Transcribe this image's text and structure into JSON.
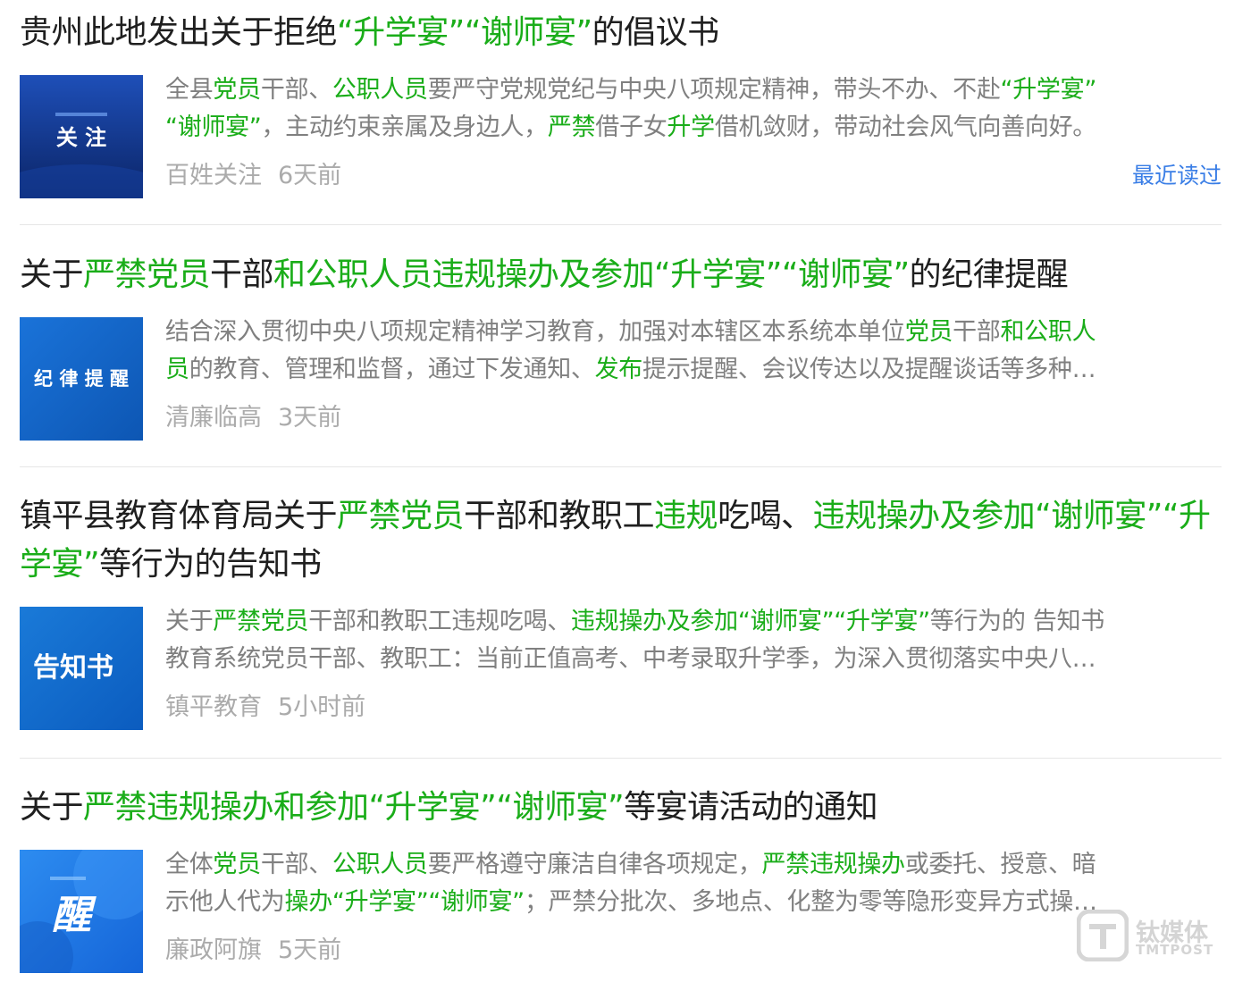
{
  "results": [
    {
      "title_parts": [
        {
          "text": "贵州此地发出关于拒绝",
          "hl": false
        },
        {
          "text": "“升学宴”“谢师宴”",
          "hl": true
        },
        {
          "text": "的倡议书",
          "hl": false
        }
      ],
      "thumbnail": {
        "text": "关 注",
        "icon": "news-thumbnail"
      },
      "summary_lines": [
        [
          {
            "text": "全县",
            "hl": false
          },
          {
            "text": "党员",
            "hl": true
          },
          {
            "text": "干部、",
            "hl": false
          },
          {
            "text": "公职人员",
            "hl": true
          },
          {
            "text": "要严守党规党纪与中央八项规定精神，带头不办、不赴",
            "hl": false
          },
          {
            "text": "“升学宴”",
            "hl": true
          }
        ],
        [
          {
            "text": "“谢师宴”",
            "hl": true
          },
          {
            "text": "，主动约束亲属及身边人，",
            "hl": false
          },
          {
            "text": "严禁",
            "hl": true
          },
          {
            "text": "借子女",
            "hl": false
          },
          {
            "text": "升学",
            "hl": true
          },
          {
            "text": "借机敛财，带动社会风气向善向好。",
            "hl": false
          }
        ]
      ],
      "source": "百姓关注",
      "time": "6天前",
      "recent_label": "最近读过"
    },
    {
      "title_parts": [
        {
          "text": "关于",
          "hl": false
        },
        {
          "text": "严禁党员",
          "hl": true
        },
        {
          "text": "干部",
          "hl": false
        },
        {
          "text": "和公职人员违规操办及参加“升学宴”“谢师宴”",
          "hl": true
        },
        {
          "text": "的纪律提醒",
          "hl": false
        }
      ],
      "thumbnail": {
        "text": "纪 律 提 醒",
        "icon": "news-thumbnail"
      },
      "summary_lines": [
        [
          {
            "text": "结合深入贯彻中央八项规定精神学习教育，加强对本辖区本系统本单位",
            "hl": false
          },
          {
            "text": "党员",
            "hl": true
          },
          {
            "text": "干部",
            "hl": false
          },
          {
            "text": "和公职人",
            "hl": true
          }
        ],
        [
          {
            "text": "员",
            "hl": true
          },
          {
            "text": "的教育、管理和监督，通过下发通知、",
            "hl": false
          },
          {
            "text": "发布",
            "hl": true
          },
          {
            "text": "提示提醒、会议传达以及提醒谈话等多种…",
            "hl": false
          }
        ]
      ],
      "source": "清廉临高",
      "time": "3天前",
      "recent_label": ""
    },
    {
      "title_parts": [
        {
          "text": "镇平县教育体育局关于",
          "hl": false
        },
        {
          "text": "严禁党员",
          "hl": true
        },
        {
          "text": "干部和教职工",
          "hl": false
        },
        {
          "text": "违规",
          "hl": true
        },
        {
          "text": "吃喝、",
          "hl": false
        },
        {
          "text": "违规操办及参加“谢师宴”“升学宴”",
          "hl": true
        },
        {
          "text": "等行为的告知书",
          "hl": false
        }
      ],
      "thumbnail": {
        "text": "告知书",
        "icon": "news-thumbnail"
      },
      "summary_lines": [
        [
          {
            "text": "关于",
            "hl": false
          },
          {
            "text": "严禁党员",
            "hl": true
          },
          {
            "text": "干部和教职工违规吃喝、",
            "hl": false
          },
          {
            "text": "违规操办及参加“谢师宴”“升学宴”",
            "hl": true
          },
          {
            "text": "等行为的 告知书",
            "hl": false
          }
        ],
        [
          {
            "text": "教育系统党员干部、教职工：当前正值高考、中考录取升学季，为深入贯彻落实中央八…",
            "hl": false
          }
        ]
      ],
      "source": "镇平教育",
      "time": "5小时前",
      "recent_label": ""
    },
    {
      "title_parts": [
        {
          "text": "关于",
          "hl": false
        },
        {
          "text": "严禁违规操办和参加“升学宴”“谢师宴”",
          "hl": true
        },
        {
          "text": "等宴请活动的通知",
          "hl": false
        }
      ],
      "thumbnail": {
        "text": "醒",
        "icon": "news-thumbnail"
      },
      "summary_lines": [
        [
          {
            "text": "全体",
            "hl": false
          },
          {
            "text": "党员",
            "hl": true
          },
          {
            "text": "干部、",
            "hl": false
          },
          {
            "text": "公职人员",
            "hl": true
          },
          {
            "text": "要严格遵守廉洁自律各项规定，",
            "hl": false
          },
          {
            "text": "严禁违规操办",
            "hl": true
          },
          {
            "text": "或委托、授意、暗",
            "hl": false
          }
        ],
        [
          {
            "text": "示他人代为",
            "hl": false
          },
          {
            "text": "操办“升学宴”“谢师宴”",
            "hl": true
          },
          {
            "text": "；严禁分批次、多地点、化整为零等隐形变异方式操…",
            "hl": false
          }
        ]
      ],
      "source": "廉政阿旗",
      "time": "5天前",
      "recent_label": ""
    }
  ],
  "watermark": {
    "name_cn": "钛媒体",
    "name_en": "TMTPOST"
  },
  "colors": {
    "highlight": "#1aad19",
    "link": "#3a7ee6"
  }
}
